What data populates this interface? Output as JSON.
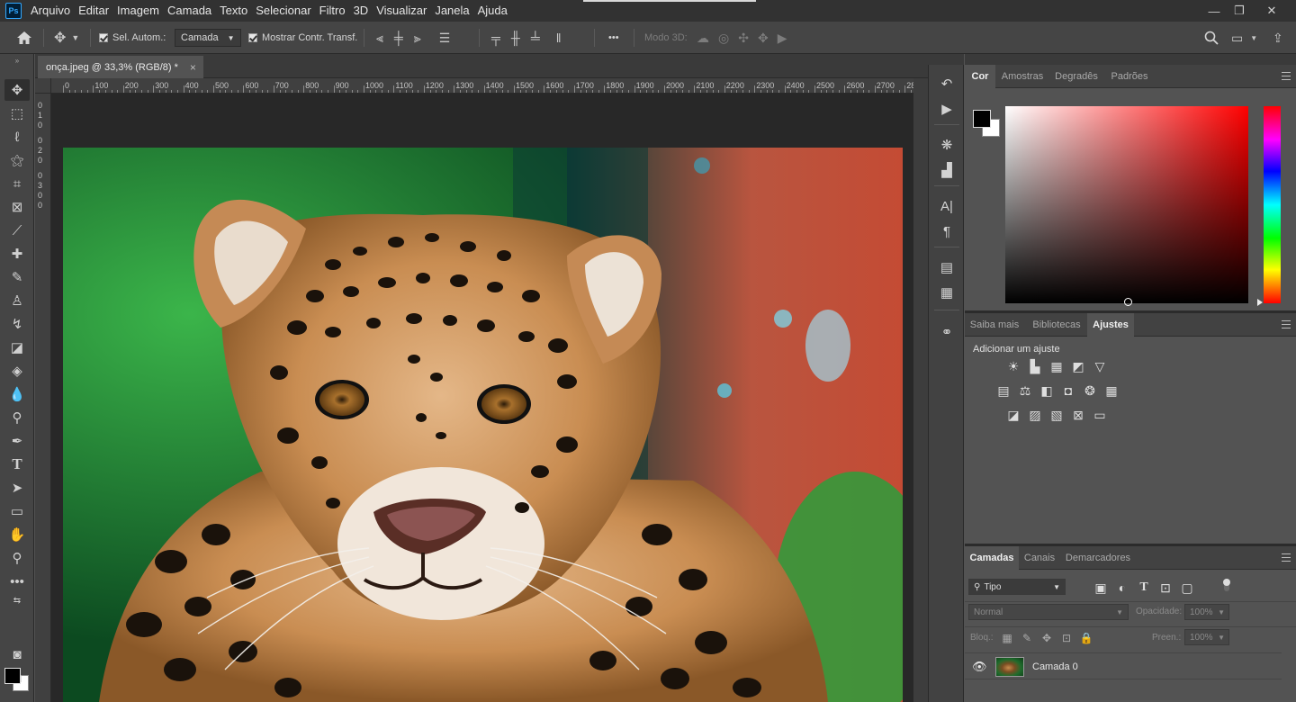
{
  "app": {
    "logo": "Ps"
  },
  "menu": [
    "Arquivo",
    "Editar",
    "Imagem",
    "Camada",
    "Texto",
    "Selecionar",
    "Filtro",
    "3D",
    "Visualizar",
    "Janela",
    "Ajuda"
  ],
  "window_controls": {
    "minimize": "—",
    "restore": "❐",
    "close": "✕"
  },
  "options": {
    "auto_select_label": "Sel. Autom.:",
    "auto_select_value": "Camada",
    "show_transform_label": "Mostrar Contr. Transf.",
    "mode3d_label": "Modo 3D:",
    "more": "•••"
  },
  "document": {
    "tab_title": "onça.jpeg @ 33,3% (RGB/8) *",
    "close": "×",
    "ruler_h": [
      "0",
      "100",
      "200",
      "300",
      "400",
      "500",
      "600",
      "700",
      "800",
      "900",
      "1000",
      "1100",
      "1200",
      "1300",
      "1400",
      "1500",
      "1600",
      "1700",
      "1800",
      "1900",
      "2000",
      "2100",
      "2200",
      "2300",
      "2400",
      "2500",
      "2600",
      "2700",
      "28"
    ],
    "ruler_v": [
      "0",
      "1",
      "0",
      "0",
      "2",
      "0",
      "0",
      "3",
      "0",
      "0"
    ]
  },
  "panels": {
    "color": {
      "tabs": [
        "Cor",
        "Amostras",
        "Degradês",
        "Padrões"
      ],
      "active": "Cor",
      "accent": "#ff0000"
    },
    "adjust": {
      "tabs": [
        "Saiba mais",
        "Bibliotecas",
        "Ajustes"
      ],
      "active": "Ajustes",
      "heading": "Adicionar um ajuste"
    },
    "layers": {
      "tabs": [
        "Camadas",
        "Canais",
        "Demarcadores"
      ],
      "active": "Camadas",
      "filter_label": "Tipo",
      "blend_mode": "Normal",
      "opacity_label": "Opacidade:",
      "opacity_value": "100%",
      "lock_label": "Bloq.:",
      "fill_label": "Preen.:",
      "fill_value": "100%",
      "layer_name": "Camada 0"
    }
  }
}
